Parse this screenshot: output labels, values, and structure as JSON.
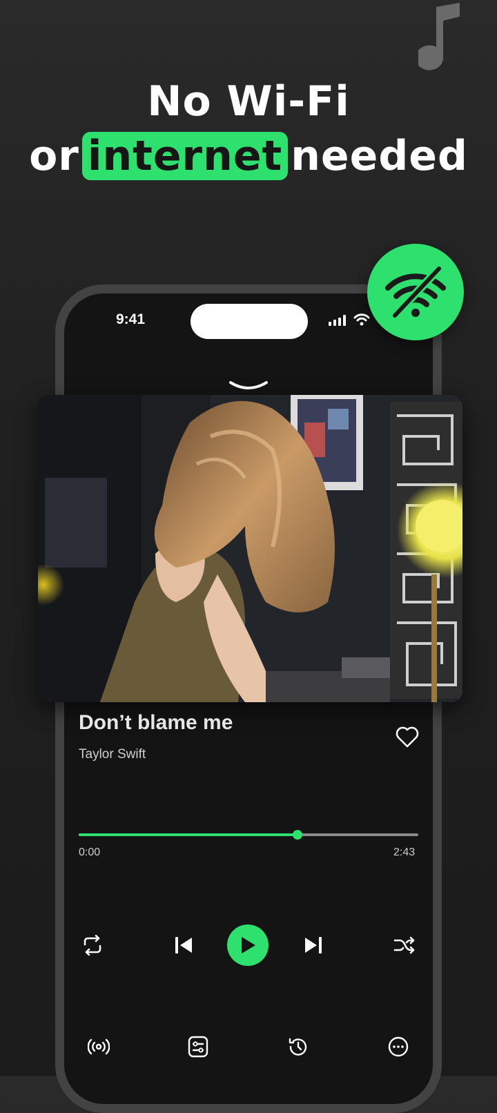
{
  "headline": {
    "line1": "No Wi-Fi",
    "line2_before": "or",
    "line2_highlight": "internet",
    "line2_after": "needed"
  },
  "status_bar": {
    "time": "9:41"
  },
  "now_playing": {
    "title": "Don’t blame me",
    "artist": "Taylor Swift",
    "elapsed": "0:00",
    "duration": "2:43",
    "progress_fraction": 0.645,
    "liked": false
  },
  "controls": [
    "repeat-icon",
    "previous-icon",
    "play-icon",
    "next-icon",
    "shuffle-icon"
  ],
  "bottom_nav": [
    "broadcast-icon",
    "equalizer-icon",
    "history-icon",
    "more-icon"
  ],
  "colors": {
    "accent": "#2ee06e",
    "background": "#202020",
    "phone_frame": "#434343"
  }
}
